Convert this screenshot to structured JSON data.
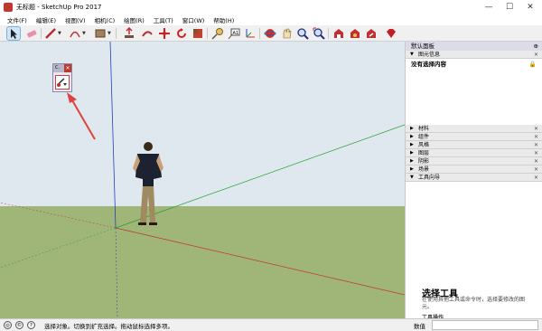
{
  "window": {
    "title": "无标题 - SketchUp Pro 2017",
    "minimize": "—",
    "maximize": "☐",
    "close": "✕"
  },
  "menu": [
    "文件(F)",
    "编辑(E)",
    "视图(V)",
    "相机(C)",
    "绘图(R)",
    "工具(T)",
    "窗口(W)",
    "帮助(H)"
  ],
  "toolbar": {
    "tools": [
      "select-icon",
      "eraser-icon",
      "pencil-icon",
      "arc-icon",
      "rectangle-icon",
      "push-pull-icon",
      "follow-me-icon",
      "move-icon",
      "rotate-icon",
      "scale-icon",
      "tape-measure-icon",
      "text-icon",
      "orbit-icon",
      "pan-icon",
      "zoom-icon",
      "zoom-extents-icon",
      "warehouse-icon",
      "extension-icon",
      "ruby-icon"
    ]
  },
  "mini_toolbar": {
    "title": "C.",
    "close": "✕"
  },
  "panel": {
    "title": "默认面板",
    "entity_info_label": "图元信息",
    "entity_info_text": "没有选择内容",
    "sections": [
      "材料",
      "组件",
      "风格",
      "图层",
      "阴影",
      "场景",
      "工具向导"
    ],
    "instructor": {
      "title": "选择工具",
      "text": "在使用其他工具或命令时，选择要修改的图元。",
      "subtitle": "工具操作"
    }
  },
  "status": {
    "message": "选择对象。切换到扩充选择。拖动鼠标选择多项。",
    "measurements_label": "数值"
  },
  "colors": {
    "sky": "#dfe8ef",
    "ground": "#a0b678",
    "axis_red": "#c0392b",
    "axis_green": "#27a02f",
    "axis_blue": "#2040c0",
    "arrow": "#e04040"
  }
}
